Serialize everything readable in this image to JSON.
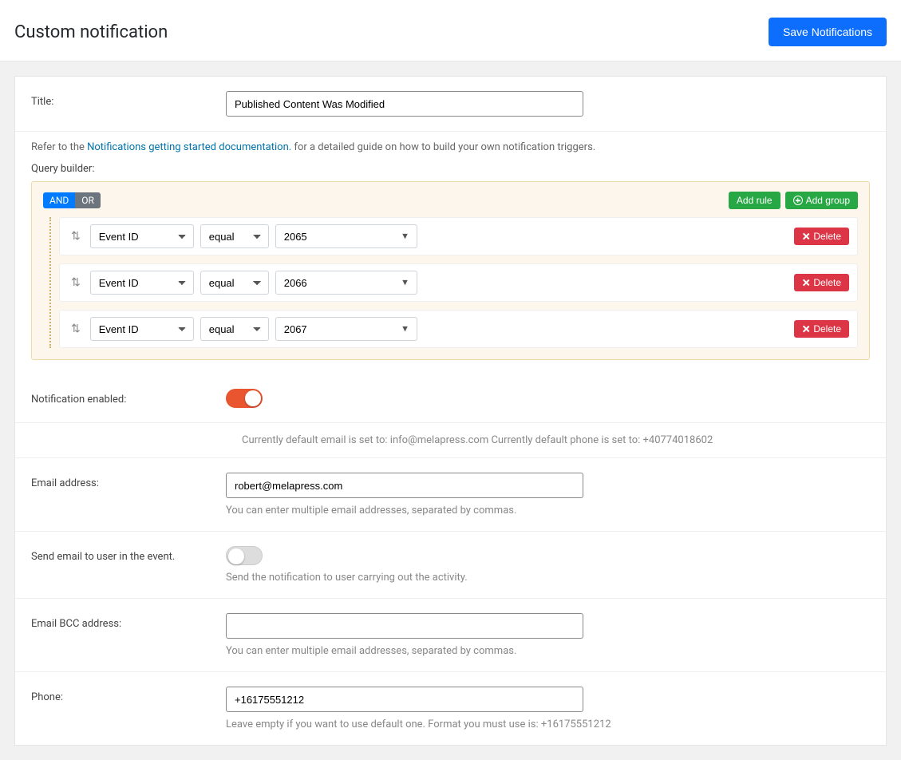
{
  "header": {
    "title": "Custom notification",
    "save_label": "Save Notifications"
  },
  "title_row": {
    "label": "Title:",
    "value": "Published Content Was Modified"
  },
  "refer": {
    "prefix": "Refer to the ",
    "link": "Notifications getting started documentation.",
    "suffix": " for a detailed guide on how to build your own notification triggers."
  },
  "qb": {
    "label": "Query builder:",
    "and": "AND",
    "or": "OR",
    "add_rule": "Add rule",
    "add_group": "Add group",
    "delete": "Delete",
    "rules": [
      {
        "field": "Event ID",
        "op": "equal",
        "value": "2065"
      },
      {
        "field": "Event ID",
        "op": "equal",
        "value": "2066"
      },
      {
        "field": "Event ID",
        "op": "equal",
        "value": "2067"
      }
    ]
  },
  "enabled": {
    "label": "Notification enabled:",
    "on": true
  },
  "defaults_info": "Currently default email is set to: info@melapress.com Currently default phone is set to: +40774018602",
  "email": {
    "label": "Email address:",
    "value": "robert@melapress.com",
    "help": "You can enter multiple email addresses, separated by commas."
  },
  "send_user": {
    "label": "Send email to user in the event.",
    "on": false,
    "help": "Send the notification to user carrying out the activity."
  },
  "bcc": {
    "label": "Email BCC address:",
    "value": "",
    "help": "You can enter multiple email addresses, separated by commas."
  },
  "phone": {
    "label": "Phone:",
    "value": "+16175551212",
    "help": "Leave empty if you want to use default one. Format you must use is: +16175551212"
  }
}
